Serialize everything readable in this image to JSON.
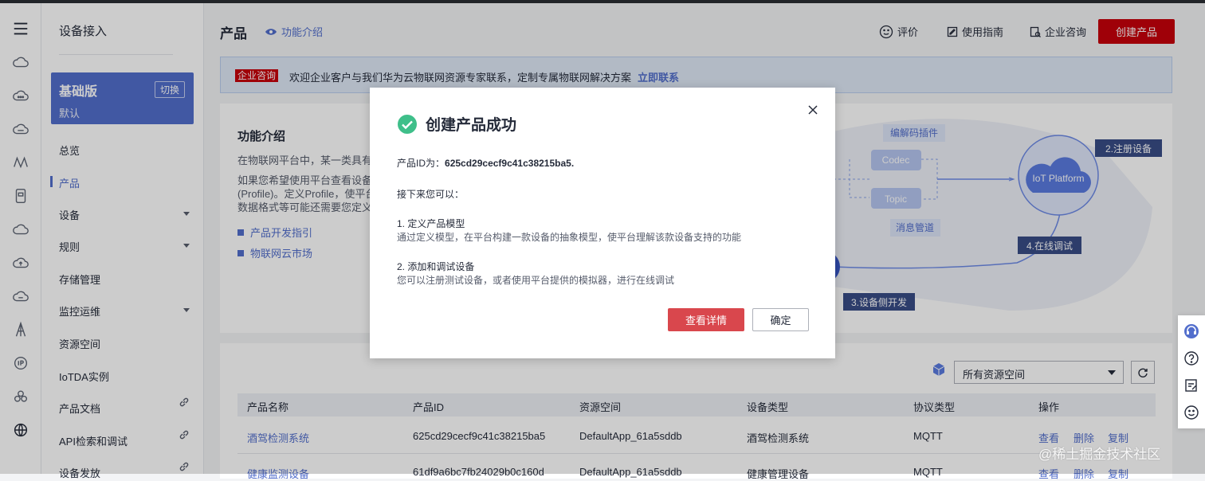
{
  "menu": {
    "title": "设备接入",
    "edition": {
      "name": "基础版",
      "desc": "默认",
      "switch_label": "切换"
    },
    "items": [
      {
        "label": "总览"
      },
      {
        "label": "产品"
      },
      {
        "label": "设备"
      },
      {
        "label": "规则"
      },
      {
        "label": "存储管理"
      },
      {
        "label": "监控运维"
      },
      {
        "label": "资源空间"
      },
      {
        "label": "IoTDA实例"
      },
      {
        "label": "产品文档"
      },
      {
        "label": "API检索和调试"
      },
      {
        "label": "设备发放"
      }
    ]
  },
  "header": {
    "title": "产品",
    "feature_intro": "功能介绍",
    "rate": "评价",
    "guide": "使用指南",
    "consult": "企业咨询",
    "create_button": "创建产品"
  },
  "banner": {
    "tag": "企业咨询",
    "text": "欢迎企业客户与我们华为云物联网资源专家联系，定制专属物联网解决方案",
    "link": "立即联系"
  },
  "intro": {
    "title": "功能介绍",
    "lines": [
      "在物联网平台中，某一类具有",
      "如果您希望使用平台查看设备",
      "(Profile)。定义Profile，使平台",
      "数据格式等可能还需要您定义"
    ],
    "links": [
      "产品开发指引",
      "物联网云市场"
    ],
    "diagram": {
      "codec_plugin": "编解码插件",
      "codec": "Codec",
      "topic": "Topic",
      "msg_pipe": "消息管道",
      "platform": "IoT Platform",
      "step2": "2.注册设备",
      "step3": "3.设备侧开发",
      "step4": "4.在线调试"
    }
  },
  "list": {
    "resource_select": "所有资源空间",
    "columns": [
      "产品名称",
      "产品ID",
      "资源空间",
      "设备类型",
      "协议类型",
      "操作"
    ],
    "rows": [
      {
        "name": "酒驾检测系统",
        "id": "625cd29cecf9c41c38215ba5",
        "space": "DefaultApp_61a5sddb",
        "type": "酒驾检测系统",
        "protocol": "MQTT",
        "view": "查看",
        "del": "删除",
        "copy": "复制"
      },
      {
        "name": "健康监测设备",
        "id": "61df9a6bc7fb24029b0c160d",
        "space": "DefaultApp_61a5sddb",
        "type": "健康管理设备",
        "protocol": "MQTT",
        "view": "查看",
        "del": "删除",
        "copy": "复制"
      }
    ]
  },
  "modal": {
    "title": "创建产品成功",
    "pid_label": "产品ID为：",
    "pid_value": "625cd29cecf9c41c38215ba5.",
    "next": "接下来您可以：",
    "step1_title": "1. 定义产品模型",
    "step1_desc": "通过定义模型，在平台构建一款设备的抽象模型，使平台理解该款设备支持的功能",
    "step2_title": "2. 添加和调试设备",
    "step2_desc": "您可以注册测试设备，或者使用平台提供的模拟器，进行在线调试",
    "detail_button": "查看详情",
    "ok_button": "确定"
  },
  "watermark": "@稀土掘金技术社区",
  "colors": {
    "brand_red": "#c7000b",
    "link_blue": "#526ecc",
    "success_green": "#3fbf8a"
  }
}
